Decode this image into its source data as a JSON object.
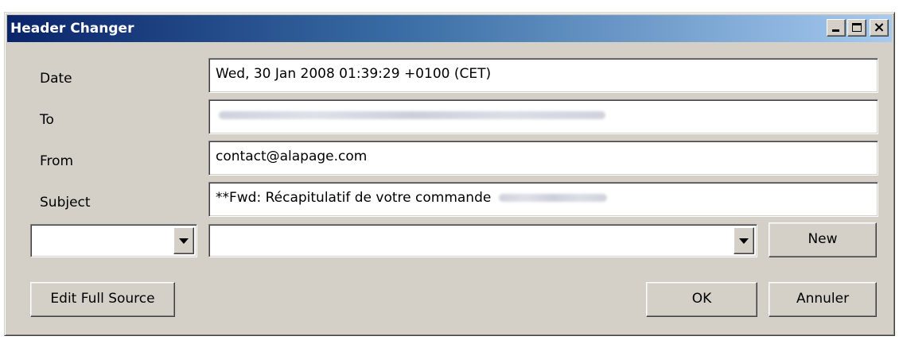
{
  "window": {
    "title": "Header Changer",
    "controls": {
      "minimize": "minimize-icon",
      "maximize": "maximize-icon",
      "close": "close-icon"
    }
  },
  "fields": {
    "date": {
      "label": "Date",
      "value": "Wed, 30 Jan 2008 01:39:29 +0100 (CET)"
    },
    "to": {
      "label": "To",
      "value": ""
    },
    "from": {
      "label": "From",
      "value": "contact@alapage.com"
    },
    "subject": {
      "label": "Subject",
      "value": "**Fwd: Récapitulatif de votre commande"
    }
  },
  "header_combo": {
    "selected": ""
  },
  "value_combo": {
    "selected": ""
  },
  "buttons": {
    "new": "New",
    "edit_full_source": "Edit Full Source",
    "ok": "OK",
    "cancel": "Annuler"
  },
  "colors": {
    "dialog_bg": "#d4d0c8",
    "title_gradient_start": "#0a246a",
    "title_gradient_end": "#a6caf0",
    "title_text": "#ffffff"
  }
}
